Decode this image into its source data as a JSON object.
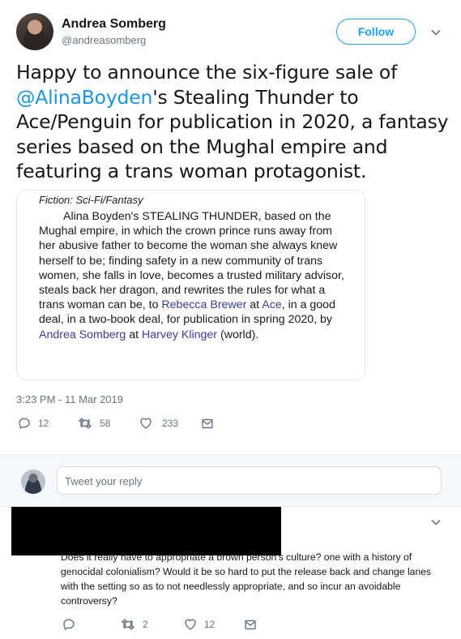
{
  "tweet": {
    "author_name": "Andrea Somberg",
    "author_handle": "@andreasomberg",
    "follow_label": "Follow",
    "text_before": "Happy to announce the six-figure sale of ",
    "mention": "@AlinaBoyden",
    "text_after": "'s Stealing Thunder to Ace/Penguin for publication in 2020, a fantasy series based on the Mughal empire and featuring a trans woman protagonist.",
    "media": {
      "category": "Fiction: Sci-Fi/Fantasy",
      "body_1": "Alina Boyden's STEALING THUNDER, based on the Mughal empire, in which the crown prince runs away from her abusive father to become the woman she always knew herself to be; finding safety in a new community of trans women, she falls in love, becomes a trusted military advisor, steals back her dragon, and rewrites the rules for what a trans woman can be, to ",
      "link_1": "Rebecca Brewer",
      "body_2": " at ",
      "link_2": "Ace",
      "body_3": ", in a good deal, in a two-book deal, for publication in spring 2020, by ",
      "link_3": "Andrea Somberg",
      "body_4": " at ",
      "link_4": "Harvey Klinger",
      "body_5": " (world)."
    },
    "timestamp": "3:23 PM - 11 Mar 2019",
    "reply_count": "12",
    "retweet_count": "58",
    "like_count": "233"
  },
  "reply_box": {
    "placeholder": "Tweet your reply"
  },
  "reply": {
    "text": "Does it really have to appropriate a brown person's culture? one with a history of genocidal colonialism? Would it be so hard to put the release back and change lanes with the setting so as to not needlessly appropriate, and so incur an avoidable controversy?",
    "reply_count": "",
    "retweet_count": "2",
    "like_count": "12"
  },
  "icons": {
    "reply": "reply-icon",
    "retweet": "retweet-icon",
    "like": "heart-icon",
    "dm": "envelope-icon",
    "more": "chevron-down-icon"
  },
  "colors": {
    "accent": "#1da1f2",
    "link": "#1b95e0",
    "muted": "#657786"
  }
}
